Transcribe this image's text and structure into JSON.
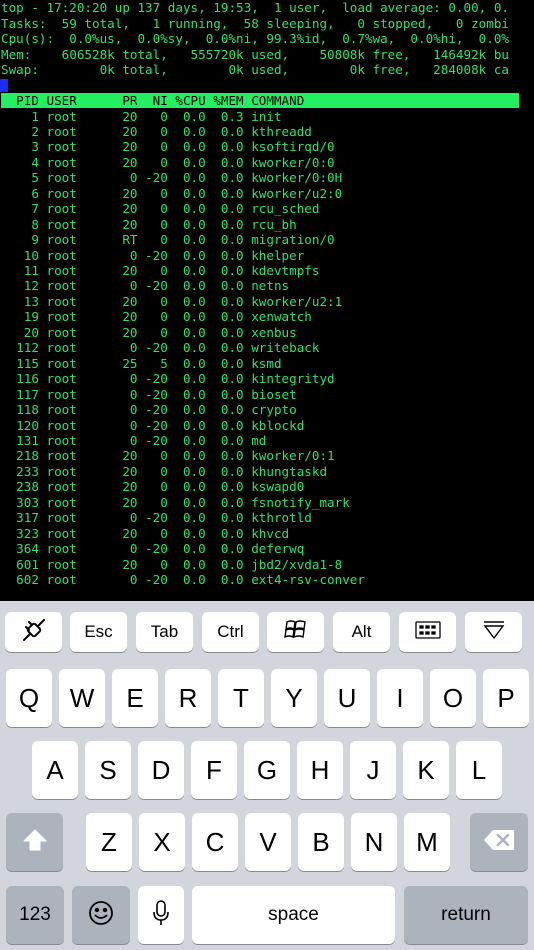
{
  "terminal": {
    "summary": [
      "top - 17:20:20 up 137 days, 19:53,  1 user,  load average: 0.00, 0.",
      "Tasks:  59 total,   1 running,  58 sleeping,   0 stopped,   0 zombi",
      "Cpu(s):  0.0%us,  0.0%sy,  0.0%ni, 99.3%id,  0.7%wa,  0.0%hi,  0.0%",
      "Mem:    606528k total,   555720k used,    50808k free,   146492k bu",
      "Swap:        0k total,        0k used,        0k free,   284008k ca"
    ],
    "header": "  PID USER      PR  NI %CPU %MEM COMMAND",
    "processes": [
      "    1 root      20   0  0.0  0.3 init",
      "    2 root      20   0  0.0  0.0 kthreadd",
      "    3 root      20   0  0.0  0.0 ksoftirqd/0",
      "    4 root      20   0  0.0  0.0 kworker/0:0",
      "    5 root       0 -20  0.0  0.0 kworker/0:0H",
      "    6 root      20   0  0.0  0.0 kworker/u2:0",
      "    7 root      20   0  0.0  0.0 rcu_sched",
      "    8 root      20   0  0.0  0.0 rcu_bh",
      "    9 root      RT   0  0.0  0.0 migration/0",
      "   10 root       0 -20  0.0  0.0 khelper",
      "   11 root      20   0  0.0  0.0 kdevtmpfs",
      "   12 root       0 -20  0.0  0.0 netns",
      "   13 root      20   0  0.0  0.0 kworker/u2:1",
      "   19 root      20   0  0.0  0.0 xenwatch",
      "   20 root      20   0  0.0  0.0 xenbus",
      "  112 root       0 -20  0.0  0.0 writeback",
      "  115 root      25   5  0.0  0.0 ksmd",
      "  116 root       0 -20  0.0  0.0 kintegrityd",
      "  117 root       0 -20  0.0  0.0 bioset",
      "  118 root       0 -20  0.0  0.0 crypto",
      "  120 root       0 -20  0.0  0.0 kblockd",
      "  131 root       0 -20  0.0  0.0 md",
      "  218 root      20   0  0.0  0.0 kworker/0:1",
      "  233 root      20   0  0.0  0.0 khungtaskd",
      "  238 root      20   0  0.0  0.0 kswapd0",
      "  303 root      20   0  0.0  0.0 fsnotify_mark",
      "  317 root       0 -20  0.0  0.0 kthrotld",
      "  323 root      20   0  0.0  0.0 khvcd",
      "  364 root       0 -20  0.0  0.0 deferwq",
      "  601 root      20   0  0.0  0.0 jbd2/xvda1-8",
      "  602 root       0 -20  0.0  0.0 ext4-rsv-conver"
    ],
    "colors": {
      "text": "#2fe06c",
      "header_bg": "#22f060",
      "cursor": "#1a2cff",
      "bg": "#000000"
    }
  },
  "toolbar": {
    "connect_icon": "plug-icon",
    "esc": "Esc",
    "tab": "Tab",
    "ctrl": "Ctrl",
    "windows_icon": "windows-icon",
    "alt": "Alt",
    "keyboard_icon": "keyboard-icon",
    "hide_icon": "hide-keyboard-icon"
  },
  "keyboard": {
    "row1": [
      "Q",
      "W",
      "E",
      "R",
      "T",
      "Y",
      "U",
      "I",
      "O",
      "P"
    ],
    "row2": [
      "A",
      "S",
      "D",
      "F",
      "G",
      "H",
      "J",
      "K",
      "L"
    ],
    "row3": [
      "Z",
      "X",
      "C",
      "V",
      "B",
      "N",
      "M"
    ],
    "numbers": "123",
    "space": "space",
    "return": "return",
    "shift_icon": "shift-icon",
    "delete_icon": "backspace-icon",
    "emoji_icon": "emoji-icon",
    "mic_icon": "microphone-icon"
  }
}
